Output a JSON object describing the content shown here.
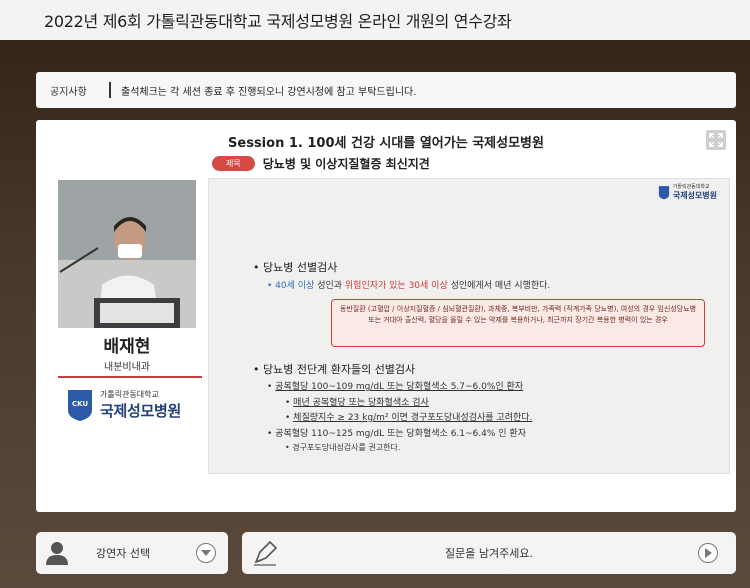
{
  "header": {
    "title": "2022년 제6회 가톨릭관동대학교 국제성모병원 온라인 개원의 연수강좌"
  },
  "notice": {
    "label": "공지사항",
    "text": "출석체크는 각 세션 종료 후 진행되오니 강연시청에 참고 부탁드립니다."
  },
  "session": {
    "title": "Session 1. 100세 건강 시대를 열어가는 국제성모병원",
    "subject_tag": "제목",
    "subject": "당뇨병 및 이상지질혈증 최신지견"
  },
  "speaker": {
    "name": "배재현",
    "department": "내분비내과",
    "logo_small": "가톨릭관동대학교",
    "logo_big": "국제성모병원",
    "logo_badge": "CKU"
  },
  "slide": {
    "logo_small": "가톨릭관동대학교",
    "logo_big": "국제성모병원",
    "bullet1_title": "당뇨병 선별검사",
    "b1_age": "40세 이상",
    "b1_mid": " 성인과 ",
    "b1_risk": "위험인자가 있는 30세 이상",
    "b1_end": " 성인에게서 매년 시행한다.",
    "callout": "동반질환 (고혈압 / 이상지질혈증 / 심뇌혈관질환), 과체중, 복부비만, 가족력 (직계가족 당뇨병), 여성의 경우 임신성당뇨병 또는 거대아 출산력, 혈당을 올릴 수 있는 약제를 복용하거나, 최근까지 장기간 복용한 병력이 있는 경우",
    "bullet2_title": "당뇨병 전단계 환자들의 선별검사",
    "l1": "공복혈당 100~109 mg/dL 또는 당화혈색소 5.7~6.0%인 환자",
    "l1a": "매년 공복혈당 또는 당화혈색소 검사",
    "l1b": "체질량지수 ≥ 23 kg/m² 이면 경구포도당내성검사를 고려한다.",
    "l2": "공복혈당 110~125 mg/dL 또는 당화혈색소 6.1~6.4% 인 환자",
    "l2a": "경구포도당내성검사를 권고한다."
  },
  "buttons": {
    "speaker_select": "강연자 선택",
    "question": "질문을 남겨주세요."
  },
  "icons": {
    "expand": "expand-icon",
    "person": "person-icon",
    "chevron_down": "chevron-down-icon",
    "pen": "pen-icon",
    "play": "play-icon"
  }
}
